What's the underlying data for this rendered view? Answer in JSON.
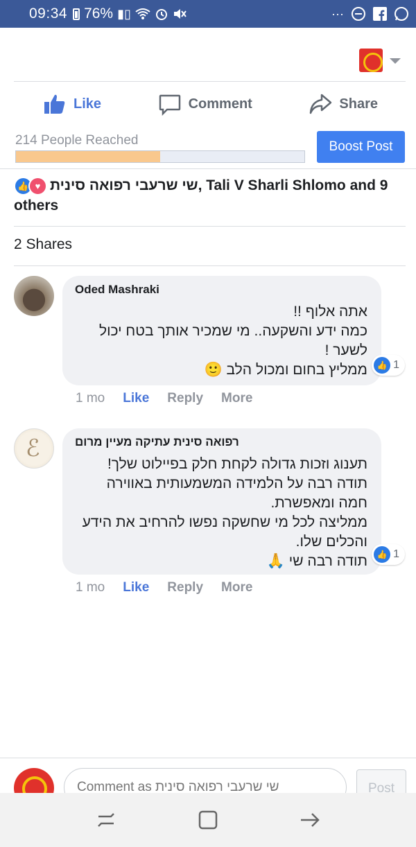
{
  "status_bar": {
    "time": "09:34",
    "battery": "76%"
  },
  "actions": {
    "like": "Like",
    "comment": "Comment",
    "share": "Share"
  },
  "reach": {
    "text": "214 People Reached",
    "progress": 0.5,
    "boost_label": "Boost Post"
  },
  "reactions": {
    "names_rtl": "שי שרעבי רפואה סינית",
    "names_rest": ", Tali V Sharli Shlomo and 9 others"
  },
  "shares": "2 Shares",
  "comments": [
    {
      "author": "Oded Mashraki",
      "text": "אתה אלוף !!\nכמה ידע והשקעה.. מי שמכיר אותך בטח יכול לשער !\nממליץ בחום ומכול הלב 🙂",
      "reaction_count": "1",
      "age": "1 mo",
      "like": "Like",
      "reply": "Reply",
      "more": "More"
    },
    {
      "author": "רפואה סינית עתיקה מעיין מרום",
      "text": "תענוג וזכות גדולה לקחת חלק בפיילוט שלך!\nתודה רבה על הלמידה המשמעותית באווירה חמה ומאפשרת.\nממליצה לכל מי שחשקה נפשו להרחיב את הידע והכלים שלו.\nתודה רבה שי 🙏",
      "reaction_count": "1",
      "age": "1 mo",
      "like": "Like",
      "reply": "Reply",
      "more": "More"
    }
  ],
  "composer": {
    "placeholder": "Comment as שי שרעבי רפואה סינית",
    "post_label": "Post"
  }
}
